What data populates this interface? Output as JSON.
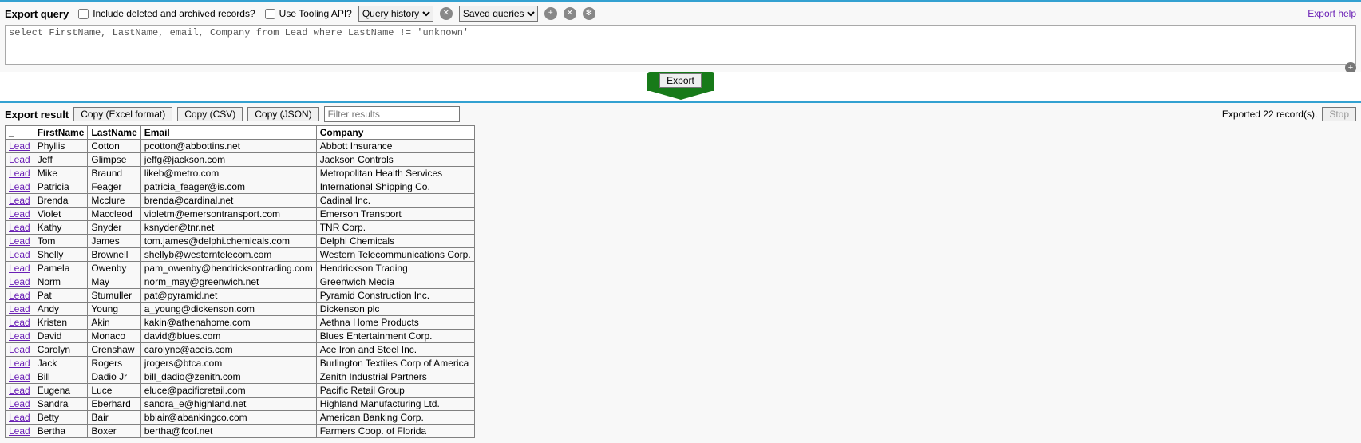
{
  "querySection": {
    "title": "Export query",
    "includeDeletedLabel": "Include deleted and archived records?",
    "useToolingLabel": "Use Tooling API?",
    "historySelected": "Query history",
    "savedSelected": "Saved queries",
    "exportHelp": "Export help",
    "queryText": "select FirstName, LastName, email, Company from Lead where LastName != 'unknown'"
  },
  "exportButtonLabel": "Export",
  "resultSection": {
    "title": "Export result",
    "copyExcel": "Copy (Excel format)",
    "copyCsv": "Copy (CSV)",
    "copyJson": "Copy (JSON)",
    "filterPlaceholder": "Filter results",
    "status": "Exported 22 record(s).",
    "stopLabel": "Stop",
    "columns": [
      "_",
      "FirstName",
      "LastName",
      "Email",
      "Company"
    ],
    "linkLabel": "Lead",
    "rows": [
      {
        "FirstName": "Phyllis",
        "LastName": "Cotton",
        "Email": "pcotton@abbottins.net",
        "Company": "Abbott Insurance"
      },
      {
        "FirstName": "Jeff",
        "LastName": "Glimpse",
        "Email": "jeffg@jackson.com",
        "Company": "Jackson Controls"
      },
      {
        "FirstName": "Mike",
        "LastName": "Braund",
        "Email": "likeb@metro.com",
        "Company": "Metropolitan Health Services"
      },
      {
        "FirstName": "Patricia",
        "LastName": "Feager",
        "Email": "patricia_feager@is.com",
        "Company": "International Shipping Co."
      },
      {
        "FirstName": "Brenda",
        "LastName": "Mcclure",
        "Email": "brenda@cardinal.net",
        "Company": "Cadinal Inc."
      },
      {
        "FirstName": "Violet",
        "LastName": "Maccleod",
        "Email": "violetm@emersontransport.com",
        "Company": "Emerson Transport"
      },
      {
        "FirstName": "Kathy",
        "LastName": "Snyder",
        "Email": "ksnyder@tnr.net",
        "Company": "TNR Corp."
      },
      {
        "FirstName": "Tom",
        "LastName": "James",
        "Email": "tom.james@delphi.chemicals.com",
        "Company": "Delphi Chemicals"
      },
      {
        "FirstName": "Shelly",
        "LastName": "Brownell",
        "Email": "shellyb@westerntelecom.com",
        "Company": "Western Telecommunications Corp."
      },
      {
        "FirstName": "Pamela",
        "LastName": "Owenby",
        "Email": "pam_owenby@hendricksontrading.com",
        "Company": "Hendrickson Trading"
      },
      {
        "FirstName": "Norm",
        "LastName": "May",
        "Email": "norm_may@greenwich.net",
        "Company": "Greenwich Media"
      },
      {
        "FirstName": "Pat",
        "LastName": "Stumuller",
        "Email": "pat@pyramid.net",
        "Company": "Pyramid Construction Inc."
      },
      {
        "FirstName": "Andy",
        "LastName": "Young",
        "Email": "a_young@dickenson.com",
        "Company": "Dickenson plc"
      },
      {
        "FirstName": "Kristen",
        "LastName": "Akin",
        "Email": "kakin@athenahome.com",
        "Company": "Aethna Home Products"
      },
      {
        "FirstName": "David",
        "LastName": "Monaco",
        "Email": "david@blues.com",
        "Company": "Blues Entertainment Corp."
      },
      {
        "FirstName": "Carolyn",
        "LastName": "Crenshaw",
        "Email": "carolync@aceis.com",
        "Company": "Ace Iron and Steel Inc."
      },
      {
        "FirstName": "Jack",
        "LastName": "Rogers",
        "Email": "jrogers@btca.com",
        "Company": "Burlington Textiles Corp of America"
      },
      {
        "FirstName": "Bill",
        "LastName": "Dadio Jr",
        "Email": "bill_dadio@zenith.com",
        "Company": "Zenith Industrial Partners"
      },
      {
        "FirstName": "Eugena",
        "LastName": "Luce",
        "Email": "eluce@pacificretail.com",
        "Company": "Pacific Retail Group"
      },
      {
        "FirstName": "Sandra",
        "LastName": "Eberhard",
        "Email": "sandra_e@highland.net",
        "Company": "Highland Manufacturing Ltd."
      },
      {
        "FirstName": "Betty",
        "LastName": "Bair",
        "Email": "bblair@abankingco.com",
        "Company": "American Banking Corp."
      },
      {
        "FirstName": "Bertha",
        "LastName": "Boxer",
        "Email": "bertha@fcof.net",
        "Company": "Farmers Coop. of Florida"
      }
    ]
  }
}
